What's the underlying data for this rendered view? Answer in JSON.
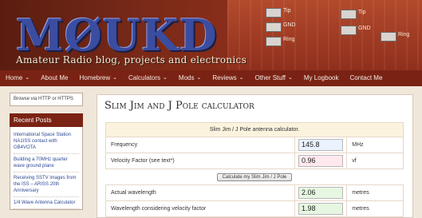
{
  "header": {
    "logo_text": "MØUKD",
    "tagline": "Amateur Radio blog, projects and electronics",
    "pcb_labels": [
      "Tip",
      "GND",
      "Ring",
      "Tip",
      "GND",
      "Ring"
    ]
  },
  "nav": {
    "items": [
      {
        "label": "Home",
        "dropdown": true
      },
      {
        "label": "About Me",
        "dropdown": false
      },
      {
        "label": "Homebrew",
        "dropdown": true
      },
      {
        "label": "Calculators",
        "dropdown": true
      },
      {
        "label": "Mods",
        "dropdown": true
      },
      {
        "label": "Reviews",
        "dropdown": true
      },
      {
        "label": "Other Stuff",
        "dropdown": true
      },
      {
        "label": "My Logbook",
        "dropdown": false
      },
      {
        "label": "Contact Me",
        "dropdown": false
      }
    ],
    "chevron": "⌄"
  },
  "sidebar": {
    "browse_text": "Browse via HTTP or HTTPS",
    "recent_title": "Recent Posts",
    "recent_posts": [
      "International Space Station NA1ISS contact with GB4VOTA",
      "Building a 70MHz quarter wave ground plane",
      "Receiving SSTV images from the ISS – ARISS 20th Anniversary",
      "1/4 Wave Antenna Calculator"
    ]
  },
  "main": {
    "title": "Slim Jim and J Pole calculator",
    "calc_header": "Slim Jim / J Pole antenna calculator.",
    "rows": {
      "frequency": {
        "label": "Frequency",
        "value": "145.8",
        "unit": "MHz"
      },
      "velocity": {
        "label": "Velocity Factor (see text*)",
        "value": "0.96",
        "unit": "vf"
      },
      "button": "Calculate my Slim Jim / J Pole",
      "actual": {
        "label": "Actual wavelength",
        "value": "2.06",
        "unit": "metres"
      },
      "vf_adjusted": {
        "label": "Wavelength considering velocity factor",
        "value": "1.98",
        "unit": "metres"
      }
    }
  },
  "colors": {
    "nav_bg": "#7a2314",
    "accent": "#7a2314",
    "link": "#2d4a95",
    "page_bg": "#efe7da"
  }
}
